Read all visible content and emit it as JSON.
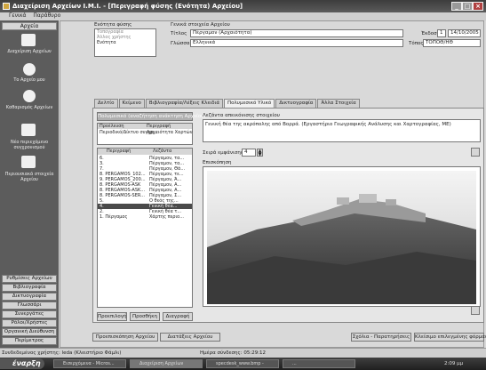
{
  "window": {
    "title": "Διαχείριση Αρχείων Ι.Μ.Ι. - [Περιγραφή φύσης (Ενότητα) Αρχείου]",
    "min": "_",
    "max": "□",
    "close": "×"
  },
  "menu": [
    "Γενικά",
    "Παράθυρο"
  ],
  "sidebar": {
    "header": "Αρχεία",
    "items": [
      "Διαχείριση Αρχείων",
      "Το Αρχείο μου",
      "Καθαρισμός Αρχείων",
      "Νέο περιεχόμενο συγχρονισμού",
      "Περιουσιακά στοιχεία Αρχείου"
    ],
    "bottom": [
      "Ρυθμίσεις Αρχείων",
      "Βιβλιογραφία",
      "Δικτυογραφία",
      "Γλωσσάρι",
      "Συνεργάτες",
      "Ρόλοι/Χρήστες",
      "Οργανική Διεύθυνση",
      "Περίμετρος"
    ]
  },
  "entity": {
    "header": "Ενότητα φύσης",
    "list": [
      "Τοπογραφία",
      "Άλλος χρήστης",
      "Ενότητα"
    ]
  },
  "general": {
    "header": "Γενικά στοιχεία Αρχείου",
    "title_label": "Τίτλος",
    "title_value": "Πέργαμον (Αρχαιότητα)",
    "language_label": "Γλώσσα",
    "language_value": "Ελληνικά",
    "edition_label": "Έκδοση",
    "edition_value": "1",
    "date_value": "14/10/2005",
    "place_label": "Τόπος",
    "place_value": "ΤΟΠΟΘ/ΗΘ"
  },
  "tabs": [
    "Δελτίο",
    "Κείμενο",
    "Βιβλιογραφία/Λέξεις Κλειδιά",
    "Πολυμεσικό Υλικό",
    "Δικτυογραφία",
    "Άλλα Στοιχεία"
  ],
  "left_panel": {
    "top_button": "Πολυμεσικό (αναζήτηση ανάκτηση Αρχείου)",
    "table1_cols": [
      "Προέλευση",
      "Περιγραφή"
    ],
    "table1_rows": [
      [
        "Περιοδικό/Δίκτυο συγχρ...",
        "Αρχαιότητα Χαρτών"
      ]
    ],
    "table2_cols": [
      "Περιγραφή",
      "Λεζάντα"
    ],
    "table2_rows": [
      [
        "6.",
        "Πέργαμον, τα..."
      ],
      [
        "3.",
        "Πέργαμον, τα..."
      ],
      [
        "7.",
        "Πέργαμον, Θά..."
      ],
      [
        "8. PERGAMOS_102...",
        "Πέργαμον, τε..."
      ],
      [
        "9. PERGAMOS_200...",
        "Πέργαμον, Ά..."
      ],
      [
        "8. PERGAMOS-ASK",
        "Πέργαμον, Α..."
      ],
      [
        "8. PERGAMOS-ASK...",
        "Πέργαμον, Α..."
      ],
      [
        "8. PERGAMOS-SER...",
        "Πέργαμον, Σ..."
      ],
      [
        "5.",
        "Ο θεός της..."
      ],
      [
        "4.",
        "Γενική θέα..."
      ],
      [
        "2.",
        "Γενική θέα τ..."
      ],
      [
        "1. Πέργαμος",
        "Χάρτης περιο..."
      ]
    ],
    "buttons": [
      "Προεπιλογή",
      "Προσθήκη",
      "Διαγραφή"
    ]
  },
  "right_panel": {
    "caption_label": "Λεζάντα απεικόνισης στοιχείου",
    "caption_value": "Γενική θέα της ακρόπολης από Βορρά. (Εργαστήριο Γεωγραφικής Ανάλυσης και Χαρτογραφίας, ΜΕ)",
    "order_label": "Σειρά εμφάνισης",
    "order_value": "4",
    "preview_label": "Επισκόπηση"
  },
  "bottom_bar": {
    "left": [
      "Προεπισκόπηση Αρχείου",
      "Διατάξεις Αρχείου"
    ],
    "right": [
      "Σχόλια - Παρατηρήσεις",
      "Κλείσιμο επιλεγμένης φόρμας"
    ]
  },
  "status": {
    "user": "Συνδεδεμένος χρήστης: leda (Κλειστήριο Φάμλι)",
    "time": "Ημέρα σύνδεσης: 05:29:12"
  },
  "taskbar": {
    "start": "έναρξη",
    "tasks": [
      "Εισερχόμενα - Micros...",
      "Διαχείριση Αρχείων",
      "specdesk_www.bmp -",
      "..."
    ],
    "clock": "2:09 μμ"
  },
  "colors": {
    "sidebar": "#5c5c5c",
    "titlebar": "#3d3d3d",
    "field": "#ffffff"
  }
}
